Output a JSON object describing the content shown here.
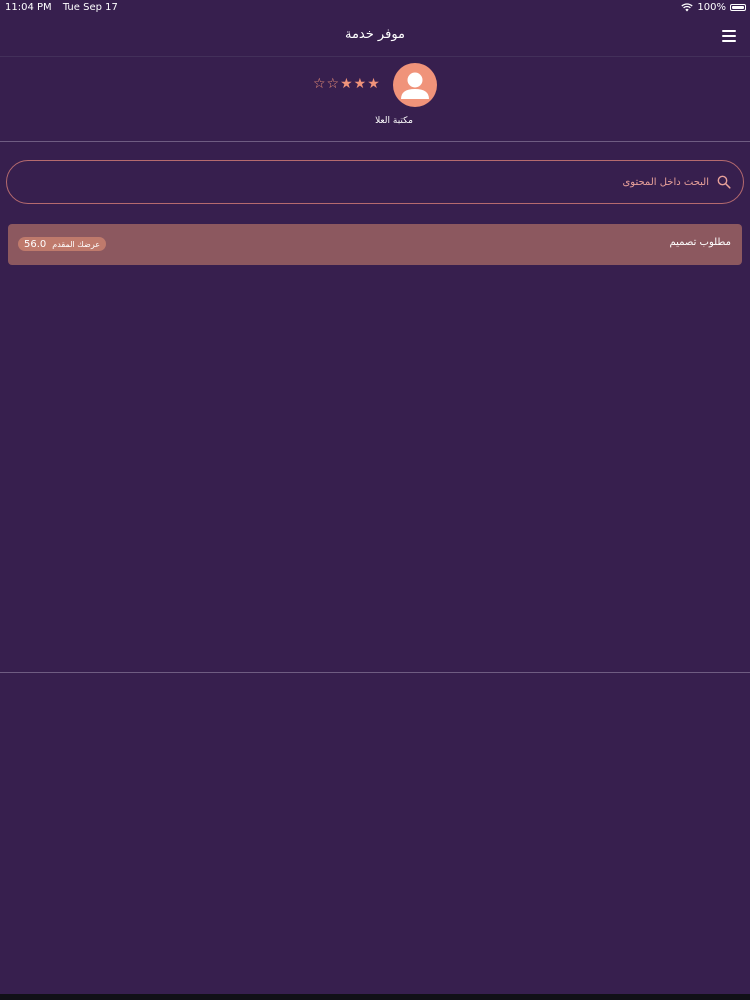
{
  "status_bar": {
    "time": "11:04 PM",
    "date": "Tue Sep 17",
    "battery": "100%",
    "battery_level": 1.0
  },
  "nav": {
    "title": "موفر خدمة",
    "menu_icon": "hamburger-menu-icon"
  },
  "profile": {
    "name": "مكتبة العلا",
    "avatar_icon": "user-avatar-icon",
    "rating": 3,
    "rating_max": 5,
    "rating_display": "☆☆★★★"
  },
  "search": {
    "placeholder": "البحث داخل المحتوى",
    "value": "",
    "icon": "search-icon"
  },
  "requests": [
    {
      "title": "مطلوب تصميم",
      "offer_label": "عرضك المقدم",
      "offer_value": "56.0"
    }
  ],
  "colors": {
    "background": "#371f4e",
    "accent": "#f0937a",
    "card": "#8c585f",
    "badge": "#bf7a6c",
    "search_border": "#b56a6e",
    "divider": "#6f5c82"
  }
}
